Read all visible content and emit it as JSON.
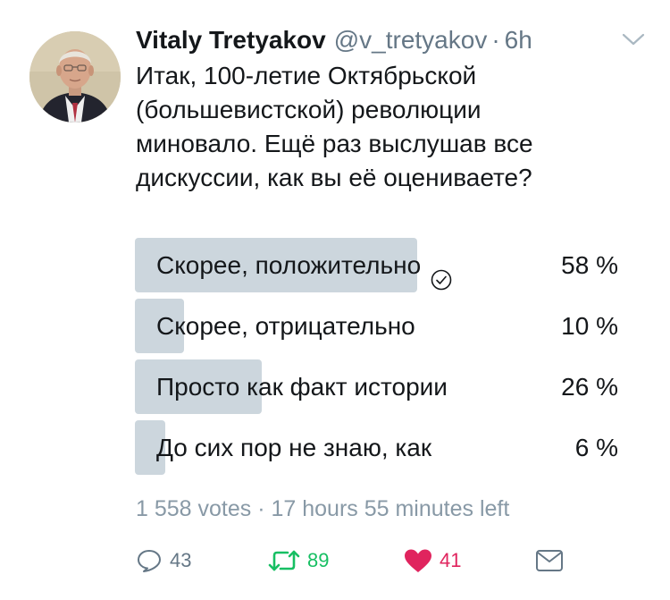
{
  "tweet": {
    "author_name": "Vitaly Tretyakov",
    "author_handle": "@v_tretyakov",
    "separator": "·",
    "time": "6h",
    "text_lines": [
      "Итак, 100-летие Октябрьской",
      "(большевистской) революции",
      "миновало. Ещё раз выслушав все",
      "дискуссии, как вы её оцениваете?"
    ]
  },
  "poll": {
    "options": [
      {
        "label": "Скорее, положительно",
        "percent_text": "58 %",
        "percent": 58,
        "selected": true
      },
      {
        "label": "Скорее, отрицательно",
        "percent_text": "10 %",
        "percent": 10,
        "selected": false
      },
      {
        "label": "Просто как факт истории",
        "percent_text": "26 %",
        "percent": 26,
        "selected": false
      },
      {
        "label": "До сих пор не знаю, как",
        "percent_text": "6 %",
        "percent": 6,
        "selected": false
      }
    ],
    "meta": "1 558 votes · 17 hours 55 minutes left"
  },
  "actions": {
    "reply": {
      "icon": "reply-icon",
      "count": "43"
    },
    "retweet": {
      "icon": "retweet-icon",
      "count": "89"
    },
    "like": {
      "icon": "heart-icon",
      "count": "41"
    },
    "dm": {
      "icon": "envelope-icon"
    }
  },
  "colors": {
    "poll_bar": "#ccd6dd",
    "secondary_text": "#657786",
    "retweet_green": "#17bf63",
    "like_red": "#e0245e"
  }
}
